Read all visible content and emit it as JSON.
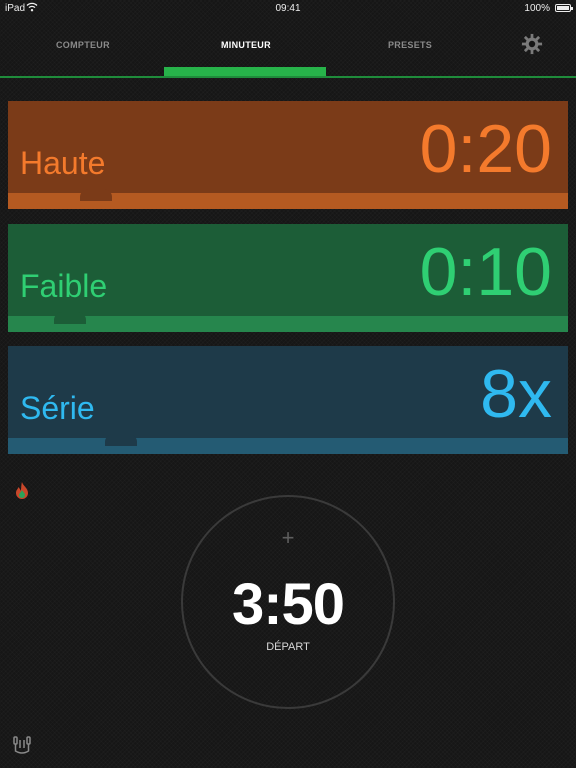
{
  "status": {
    "carrier": "iPad",
    "time": "09:41",
    "battery": "100%"
  },
  "tabs": [
    {
      "label": "COMPTEUR",
      "active": false
    },
    {
      "label": "MINUTEUR",
      "active": true
    },
    {
      "label": "PRESETS",
      "active": false
    }
  ],
  "settings_icon": "gear-icon",
  "intervals": {
    "high": {
      "label": "Haute",
      "value": "0:20",
      "color": "#f47a2c"
    },
    "low": {
      "label": "Faible",
      "value": "0:10",
      "color": "#2fcf73"
    },
    "series": {
      "label": "Série",
      "value": "8x",
      "color": "#2fb9f0"
    }
  },
  "timer": {
    "plus": "+",
    "total": "3:50",
    "start_label": "DÉPART"
  },
  "icons": {
    "flame": "flame-icon",
    "bottom": "jump-rope-icon"
  },
  "accent": "#27b34a"
}
